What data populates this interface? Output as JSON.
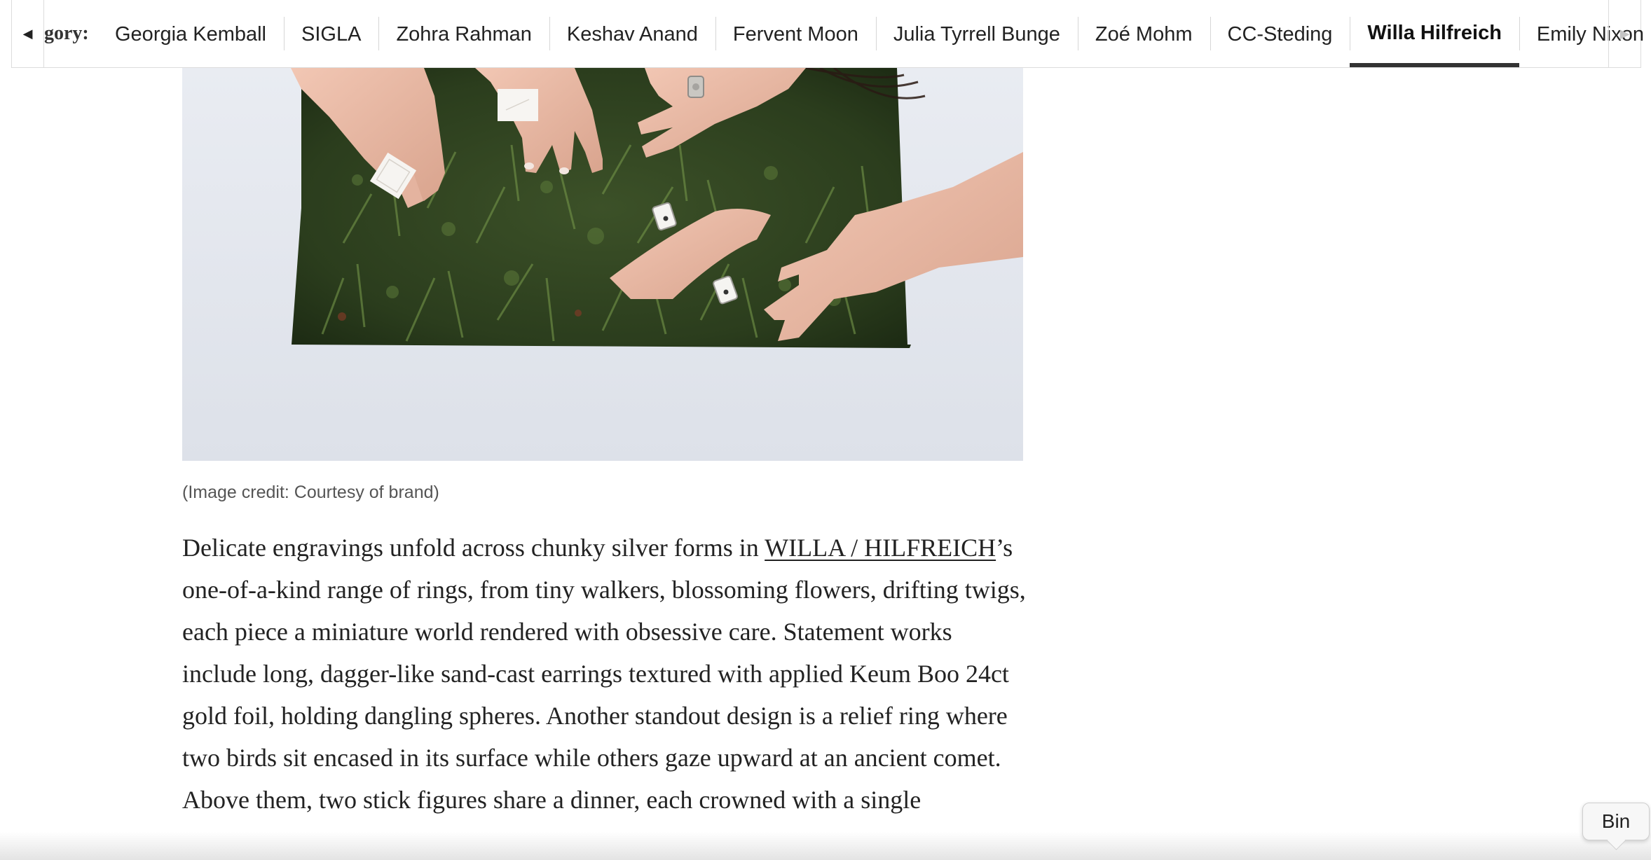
{
  "category_bar": {
    "label": "gory:",
    "prev_icon": "triangle-left-icon",
    "next_icon": "triangle-right-icon",
    "tabs": [
      {
        "label": "Georgia Kemball",
        "active": false
      },
      {
        "label": "SIGLA",
        "active": false
      },
      {
        "label": "Zohra Rahman",
        "active": false
      },
      {
        "label": "Keshav Anand",
        "active": false
      },
      {
        "label": "Fervent Moon",
        "active": false
      },
      {
        "label": "Julia Tyrrell Bunge",
        "active": false
      },
      {
        "label": "Zoé Mohm",
        "active": false
      },
      {
        "label": "CC-Steding",
        "active": false
      },
      {
        "label": "Willa Hilfreich",
        "active": true
      },
      {
        "label": "Emily Nixon",
        "active": false
      }
    ]
  },
  "article": {
    "image_caption": "(Image credit: Courtesy of brand)",
    "paragraph": {
      "before_link": "Delicate engravings unfold across chunky silver forms in ",
      "link_text": "WILLA / HILFREICH",
      "after_link": "’s one-of-a-kind range of rings, from tiny walkers, blossoming flowers, drifting twigs, each piece a miniature world rendered with obsessive care. Statement works include long, dagger-like sand-cast earrings textured with applied Keum Boo 24ct gold foil, holding dangling spheres. Another standout design is a relief ring where two birds sit encased in its surface while others gaze upward at an ancient comet. Above them, two stick figures share a dinner, each crowned with a single"
    }
  },
  "tooltip": {
    "label": "Bin"
  },
  "colors": {
    "active_underline": "#333333",
    "text": "#222222",
    "caption": "#555555",
    "border": "#dcdcdc"
  }
}
